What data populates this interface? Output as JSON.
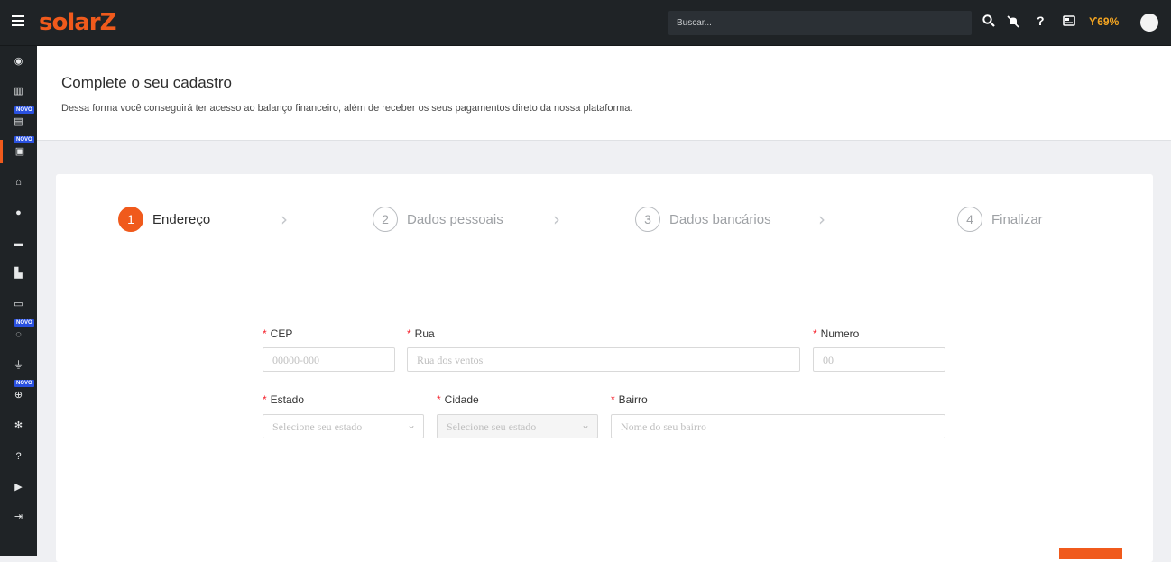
{
  "app": {
    "logo": "solarZ"
  },
  "topbar": {
    "search_placeholder": "Buscar...",
    "help_glyph": "?",
    "score": "69%",
    "icons": [
      "menu-icon",
      "search-icon",
      "notifications-off-icon",
      "help-icon",
      "news-icon",
      "medal-icon",
      "avatar"
    ]
  },
  "sidebar": {
    "badge": "NOVO",
    "items": [
      {
        "icon": "dashboard-icon"
      },
      {
        "icon": "columns-icon"
      },
      {
        "icon": "document-icon",
        "badge": true
      },
      {
        "icon": "money-icon",
        "badge": true,
        "active": true
      },
      {
        "icon": "home-icon"
      },
      {
        "icon": "user-icon"
      },
      {
        "icon": "card-icon"
      },
      {
        "icon": "chart-icon"
      },
      {
        "icon": "credit-card-icon"
      },
      {
        "icon": "whatsapp-icon",
        "badge": true
      },
      {
        "icon": "plug-icon"
      },
      {
        "icon": "search-plus-icon",
        "badge": true
      },
      {
        "icon": "gear-icon"
      },
      {
        "icon": "help-icon"
      },
      {
        "icon": "file-export-icon"
      },
      {
        "icon": "logout-icon"
      }
    ]
  },
  "header": {
    "title": "Complete o seu cadastro",
    "subtitle": "Dessa forma você conseguirá ter acesso ao balanço financeiro, além de receber os seus pagamentos direto da nossa plataforma."
  },
  "steps": [
    {
      "number": "1",
      "label": "Endereço",
      "active": true
    },
    {
      "number": "2",
      "label": "Dados pessoais",
      "active": false
    },
    {
      "number": "3",
      "label": "Dados bancários",
      "active": false
    },
    {
      "number": "4",
      "label": "Finalizar",
      "active": false
    }
  ],
  "form": {
    "required_mark": "*",
    "cep": {
      "label": "CEP",
      "placeholder": "00000-000"
    },
    "rua": {
      "label": "Rua",
      "placeholder": "Rua dos ventos"
    },
    "numero": {
      "label": "Numero",
      "placeholder": "00"
    },
    "estado": {
      "label": "Estado",
      "placeholder": "Selecione seu estado"
    },
    "cidade": {
      "label": "Cidade",
      "placeholder": "Selecione seu estado"
    },
    "bairro": {
      "label": "Bairro",
      "placeholder": "Nome do seu bairro"
    }
  },
  "colors": {
    "accent": "#f05a1c",
    "dark": "#1f2326",
    "badge": "#2a51e0",
    "required": "#f5222d"
  }
}
